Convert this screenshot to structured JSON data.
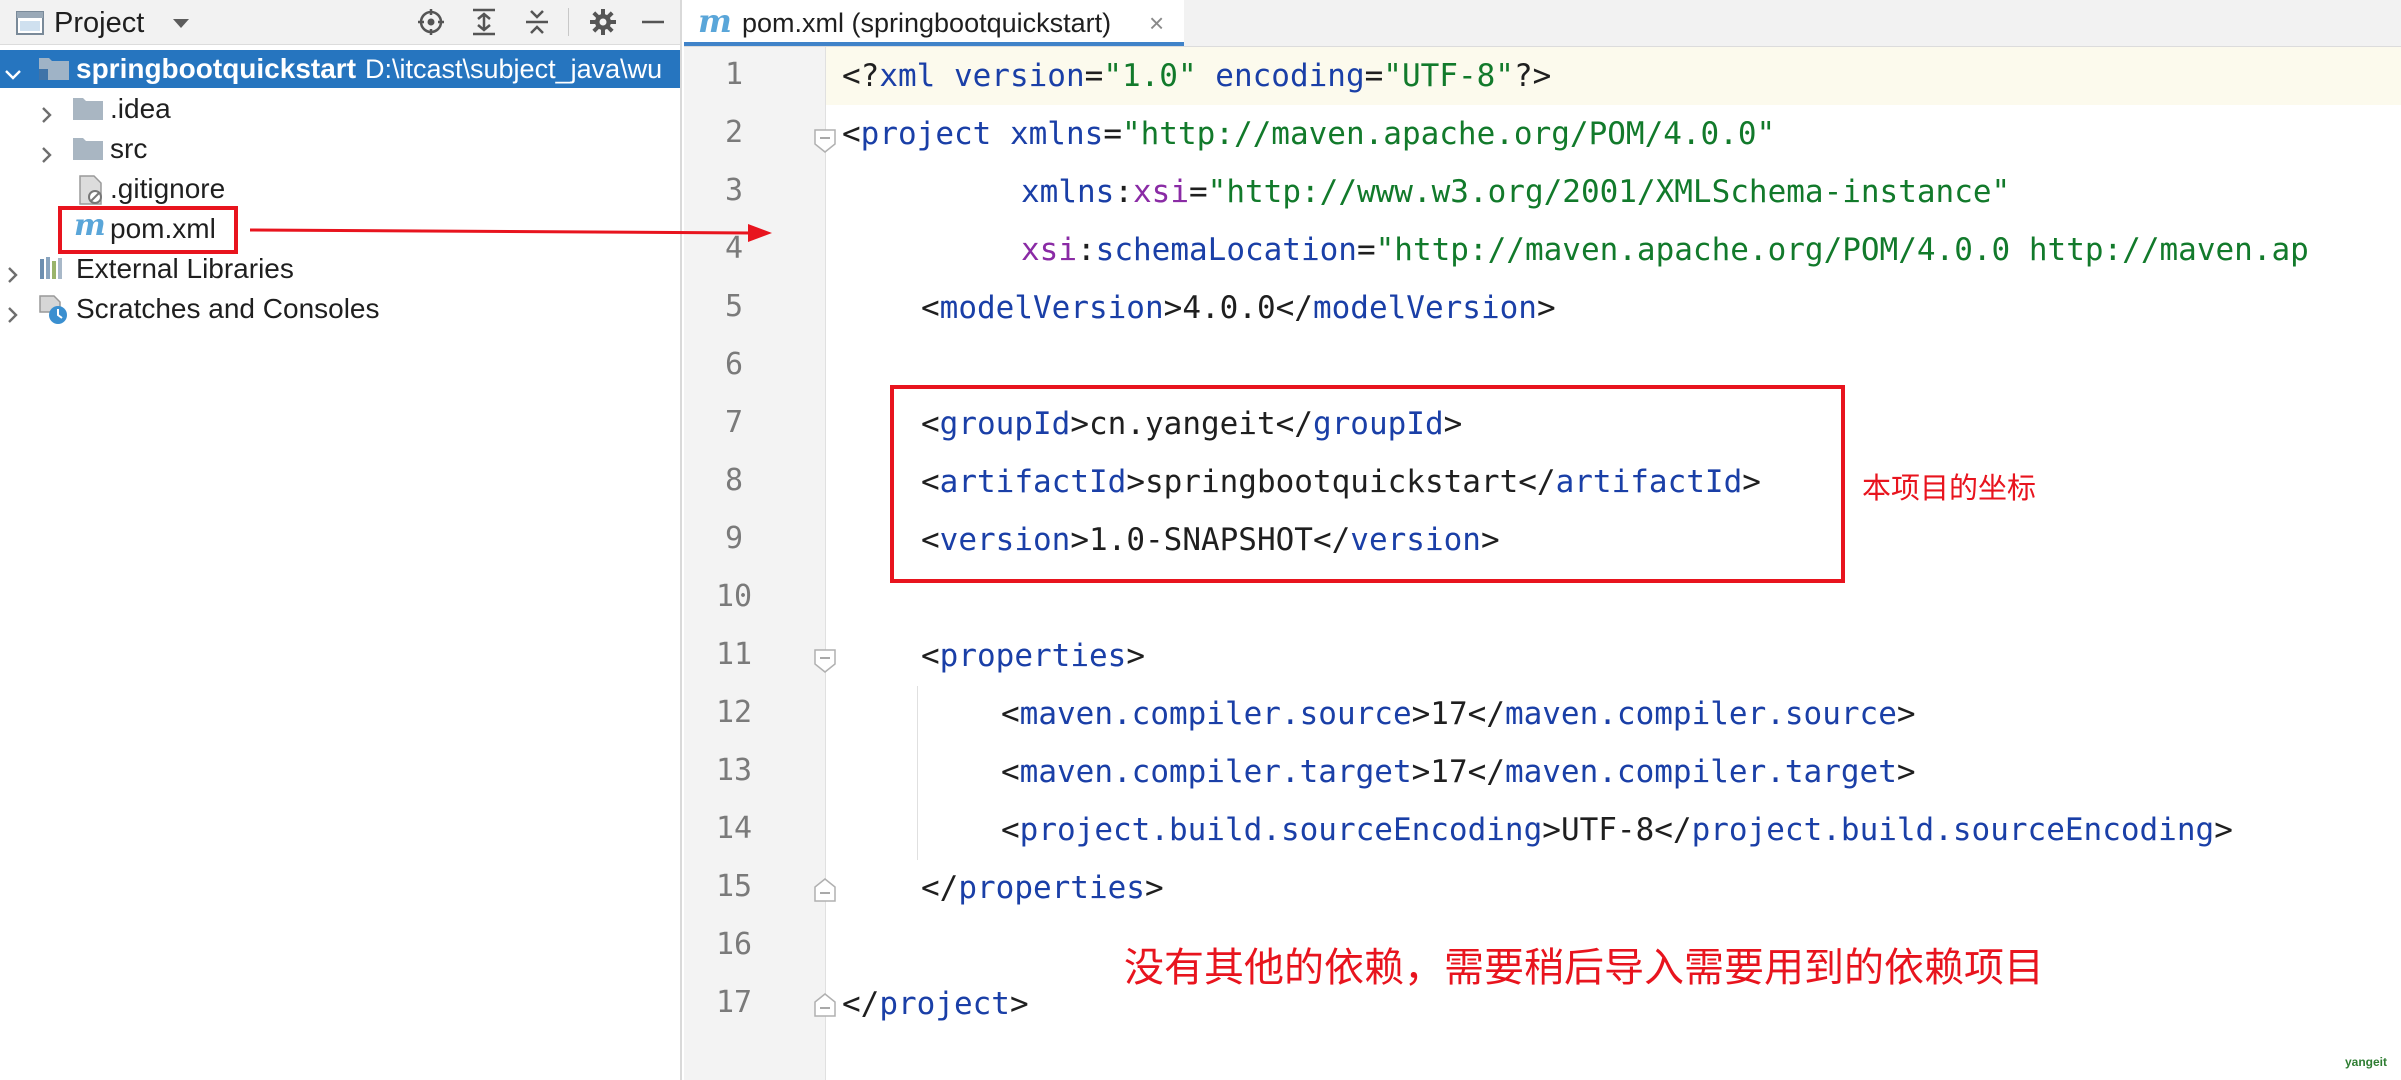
{
  "project_panel": {
    "title": "Project",
    "tree": [
      {
        "label": "springbootquickstart",
        "path": "D:\\itcast\\subject_java\\wu",
        "expanded": true,
        "selected": true,
        "type": "module-folder"
      },
      {
        "label": ".idea",
        "type": "folder",
        "expanded": false
      },
      {
        "label": "src",
        "type": "folder",
        "expanded": false
      },
      {
        "label": ".gitignore",
        "type": "ignore-file"
      },
      {
        "label": "pom.xml",
        "type": "maven-file"
      },
      {
        "label": "External Libraries",
        "type": "libraries",
        "expanded": false
      },
      {
        "label": "Scratches and Consoles",
        "type": "scratches",
        "expanded": false
      }
    ]
  },
  "editor": {
    "tab": {
      "label": "pom.xml (springbootquickstart)",
      "icon": "m",
      "close": "×"
    },
    "line_numbers": [
      "1",
      "2",
      "3",
      "4",
      "5",
      "6",
      "7",
      "8",
      "9",
      "10",
      "11",
      "12",
      "13",
      "14",
      "15",
      "16",
      "17"
    ],
    "lines": {
      "l1": [
        "<?",
        "xml version",
        "=",
        "\"1.0\"",
        " encoding",
        "=",
        "\"UTF-8\"",
        "?>"
      ],
      "l2": [
        "<",
        "project ",
        "xmlns",
        "=",
        "\"http://maven.apache.org/POM/4.0.0\""
      ],
      "l3": [
        "xmlns",
        ":",
        "xsi",
        "=",
        "\"http://www.w3.org/2001/XMLSchema-instance\""
      ],
      "l4": [
        "xsi",
        ":",
        "schemaLocation",
        "=",
        "\"http://maven.apache.org/POM/4.0.0 http://maven.ap"
      ],
      "l5": [
        "<",
        "modelVersion",
        ">",
        "4.0.0",
        "</",
        "modelVersion",
        ">"
      ],
      "l7": [
        "<",
        "groupId",
        ">",
        "cn.yangeit",
        "</",
        "groupId",
        ">"
      ],
      "l8": [
        "<",
        "artifactId",
        ">",
        "springbootquickstart",
        "</",
        "artifactId",
        ">"
      ],
      "l9": [
        "<",
        "version",
        ">",
        "1.0-SNAPSHOT",
        "</",
        "version",
        ">"
      ],
      "l11": [
        "<",
        "properties",
        ">"
      ],
      "l12": [
        "<",
        "maven.compiler.source",
        ">",
        "17",
        "</",
        "maven.compiler.source",
        ">"
      ],
      "l13": [
        "<",
        "maven.compiler.target",
        ">",
        "17",
        "</",
        "maven.compiler.target",
        ">"
      ],
      "l14": [
        "<",
        "project.build.sourceEncoding",
        ">",
        "UTF-8",
        "</",
        "project.build.sourceEncoding",
        ">"
      ],
      "l15": [
        "</",
        "properties",
        ">"
      ],
      "l17": [
        "</",
        "project",
        ">"
      ]
    }
  },
  "annotations": {
    "coordinates_note": "本项目的坐标",
    "dependencies_note": "没有其他的依赖，需要稍后导入需要用到的依赖项目",
    "watermark": "yangeit",
    "color": "#e8141e"
  }
}
